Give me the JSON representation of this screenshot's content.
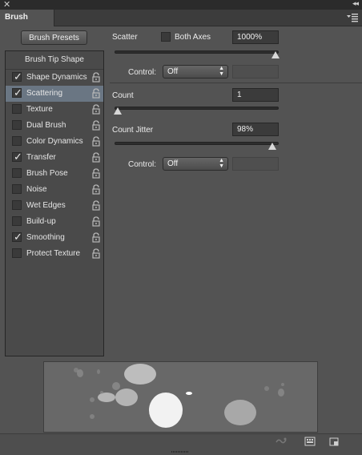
{
  "window": {
    "close_glyph": "✕",
    "collapse_glyph": "◂◂"
  },
  "panel": {
    "tab_label": "Brush",
    "menu_icon": "panel-menu-icon"
  },
  "brush_presets_button": "Brush Presets",
  "sidebar": {
    "header": "Brush Tip Shape",
    "items": [
      {
        "label": "Shape Dynamics",
        "checked": true,
        "selected": false
      },
      {
        "label": "Scattering",
        "checked": true,
        "selected": true
      },
      {
        "label": "Texture",
        "checked": false,
        "selected": false
      },
      {
        "label": "Dual Brush",
        "checked": false,
        "selected": false
      },
      {
        "label": "Color Dynamics",
        "checked": false,
        "selected": false
      },
      {
        "label": "Transfer",
        "checked": true,
        "selected": false
      },
      {
        "label": "Brush Pose",
        "checked": false,
        "selected": false
      },
      {
        "label": "Noise",
        "checked": false,
        "selected": false
      },
      {
        "label": "Wet Edges",
        "checked": false,
        "selected": false
      },
      {
        "label": "Build-up",
        "checked": false,
        "selected": false
      },
      {
        "label": "Smoothing",
        "checked": true,
        "selected": false
      },
      {
        "label": "Protect Texture",
        "checked": false,
        "selected": false
      }
    ]
  },
  "scatter": {
    "label": "Scatter",
    "both_axes_label": "Both Axes",
    "both_axes_checked": false,
    "value": "1000%",
    "slider_fraction": 1.0,
    "control_label": "Control:",
    "control_value": "Off"
  },
  "count": {
    "label": "Count",
    "value": "1",
    "slider_fraction": 0.0
  },
  "count_jitter": {
    "label": "Count Jitter",
    "value": "98%",
    "slider_fraction": 0.98,
    "control_label": "Control:",
    "control_value": "Off"
  },
  "colors": {
    "panel_bg": "#535353",
    "selected_row": "#6a7683",
    "field_bg": "#3b3b3b"
  },
  "preview": {
    "description_icon": "brush-stroke-preview"
  },
  "bottom_icons": [
    "toggle-live-tip-preview-icon",
    "open-preset-manager-icon",
    "create-new-brush-icon"
  ]
}
